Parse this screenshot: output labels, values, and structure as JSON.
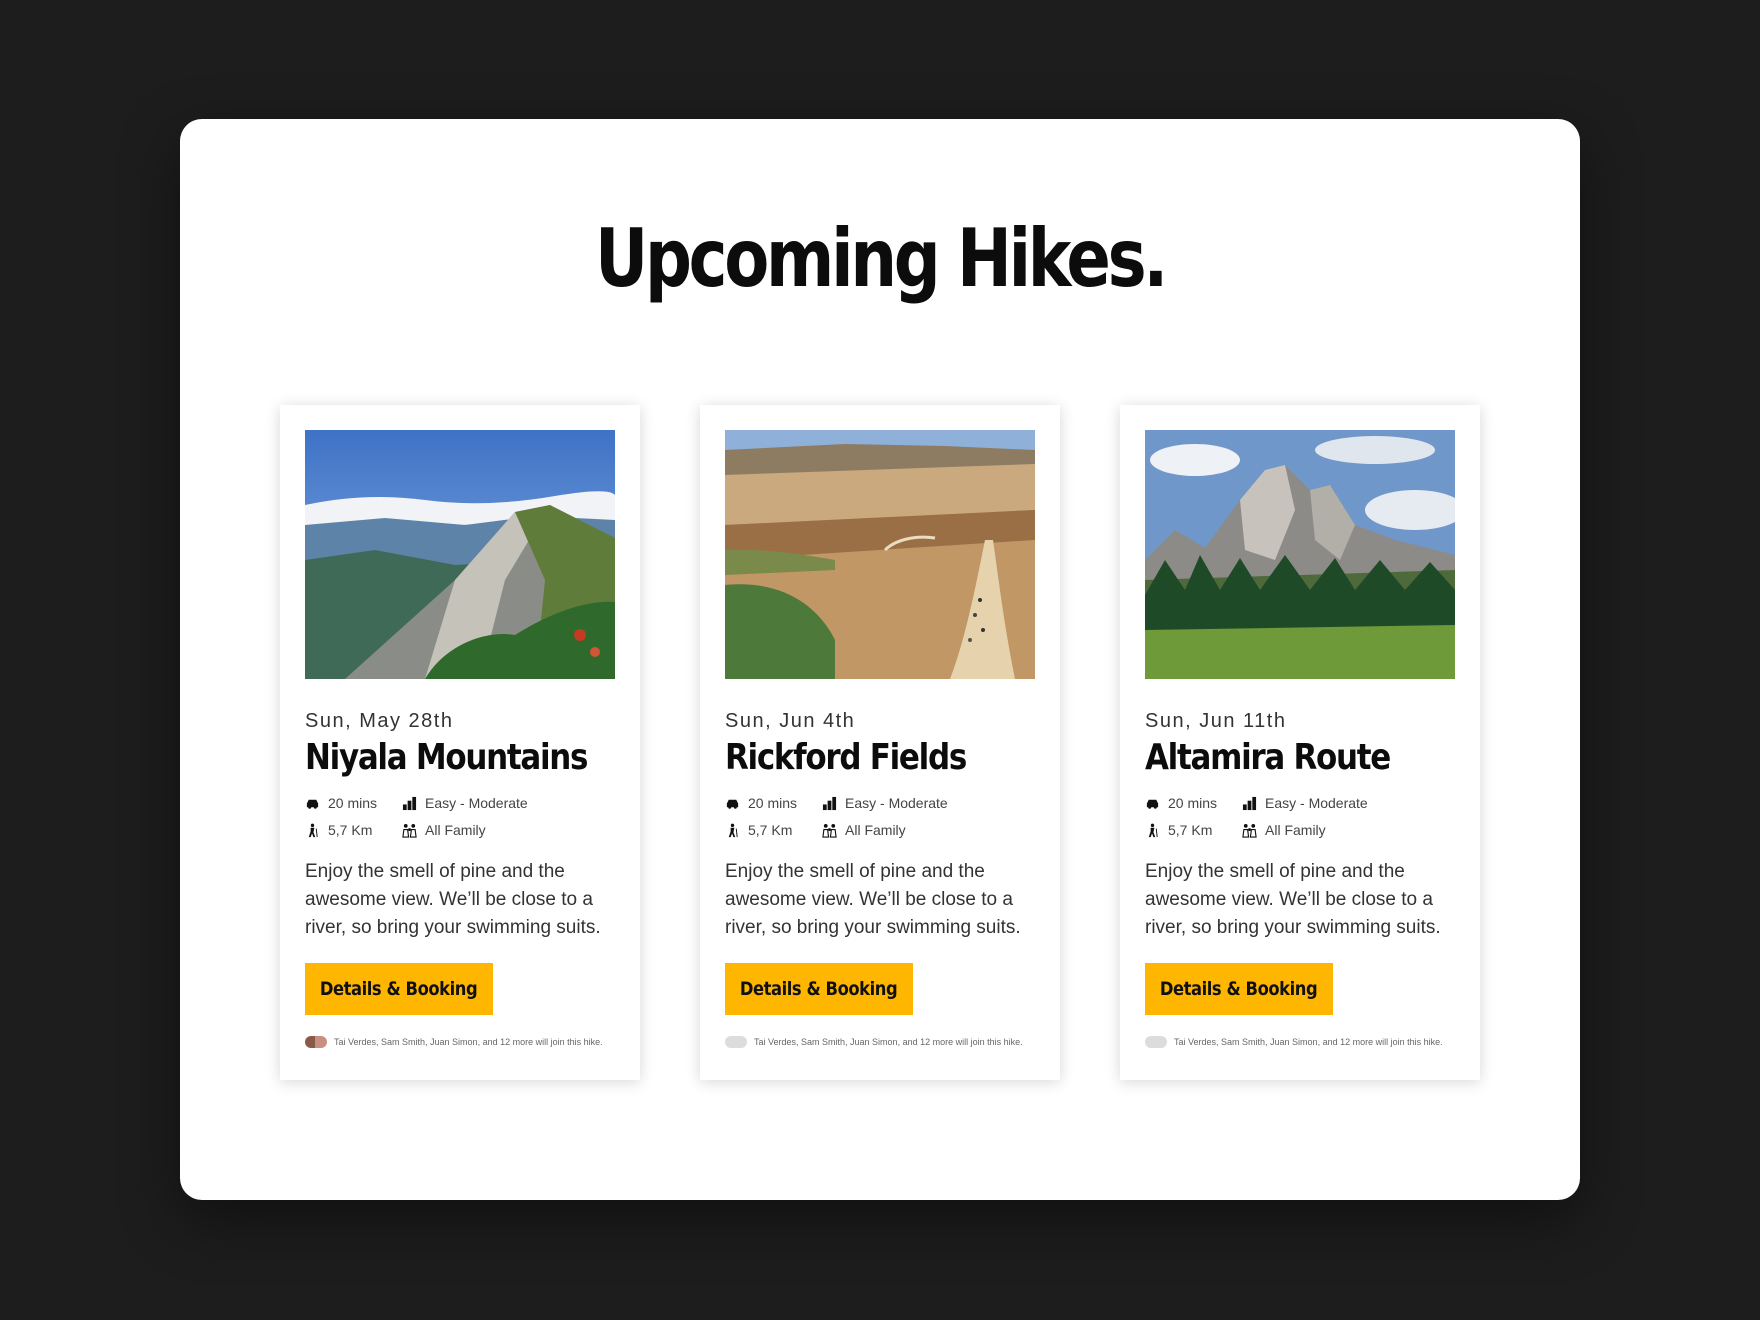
{
  "page": {
    "title": "Upcoming Hikes.",
    "cta_label": "Details & Booking",
    "accent_color": "#ffb600"
  },
  "hikes": [
    {
      "date": "Sun, May 28th",
      "name": "Niyala Mountains",
      "image": "mountain-ridge-photo",
      "time": "20 mins",
      "difficulty": "Easy - Moderate",
      "distance": "5,7 Km",
      "audience": "All Family",
      "description": "Enjoy the smell of pine and the awesome view. We’ll be close to a river, so bring your swimming suits.",
      "button": "Details & Booking",
      "attendees": "Tai Verdes, Sam Smith, Juan Simon, and 12 more will join this hike."
    },
    {
      "date": "Sun, Jun 4th",
      "name": "Rickford Fields",
      "image": "farm-fields-trail-photo",
      "time": "20 mins",
      "difficulty": "Easy - Moderate",
      "distance": "5,7 Km",
      "audience": "All Family",
      "description": "Enjoy the smell of pine and the awesome view. We’ll be close to a river, so bring your swimming suits.",
      "button": "Details & Booking",
      "attendees": "Tai Verdes, Sam Smith, Juan Simon, and 12 more will join this hike."
    },
    {
      "date": "Sun, Jun 11th",
      "name": "Altamira Route",
      "image": "rock-peak-forest-photo",
      "time": "20 mins",
      "difficulty": "Easy - Moderate",
      "distance": "5,7 Km",
      "audience": "All Family",
      "description": "Enjoy the smell of pine and the awesome view. We’ll be close to a river, so bring your swimming suits.",
      "button": "Details & Booking",
      "attendees": "Tai Verdes, Sam Smith, Juan Simon, and 12 more will join this hike."
    }
  ],
  "icons": {
    "time": "car-icon",
    "difficulty": "signal-bars-icon",
    "distance": "hiker-icon",
    "audience": "family-icon"
  }
}
